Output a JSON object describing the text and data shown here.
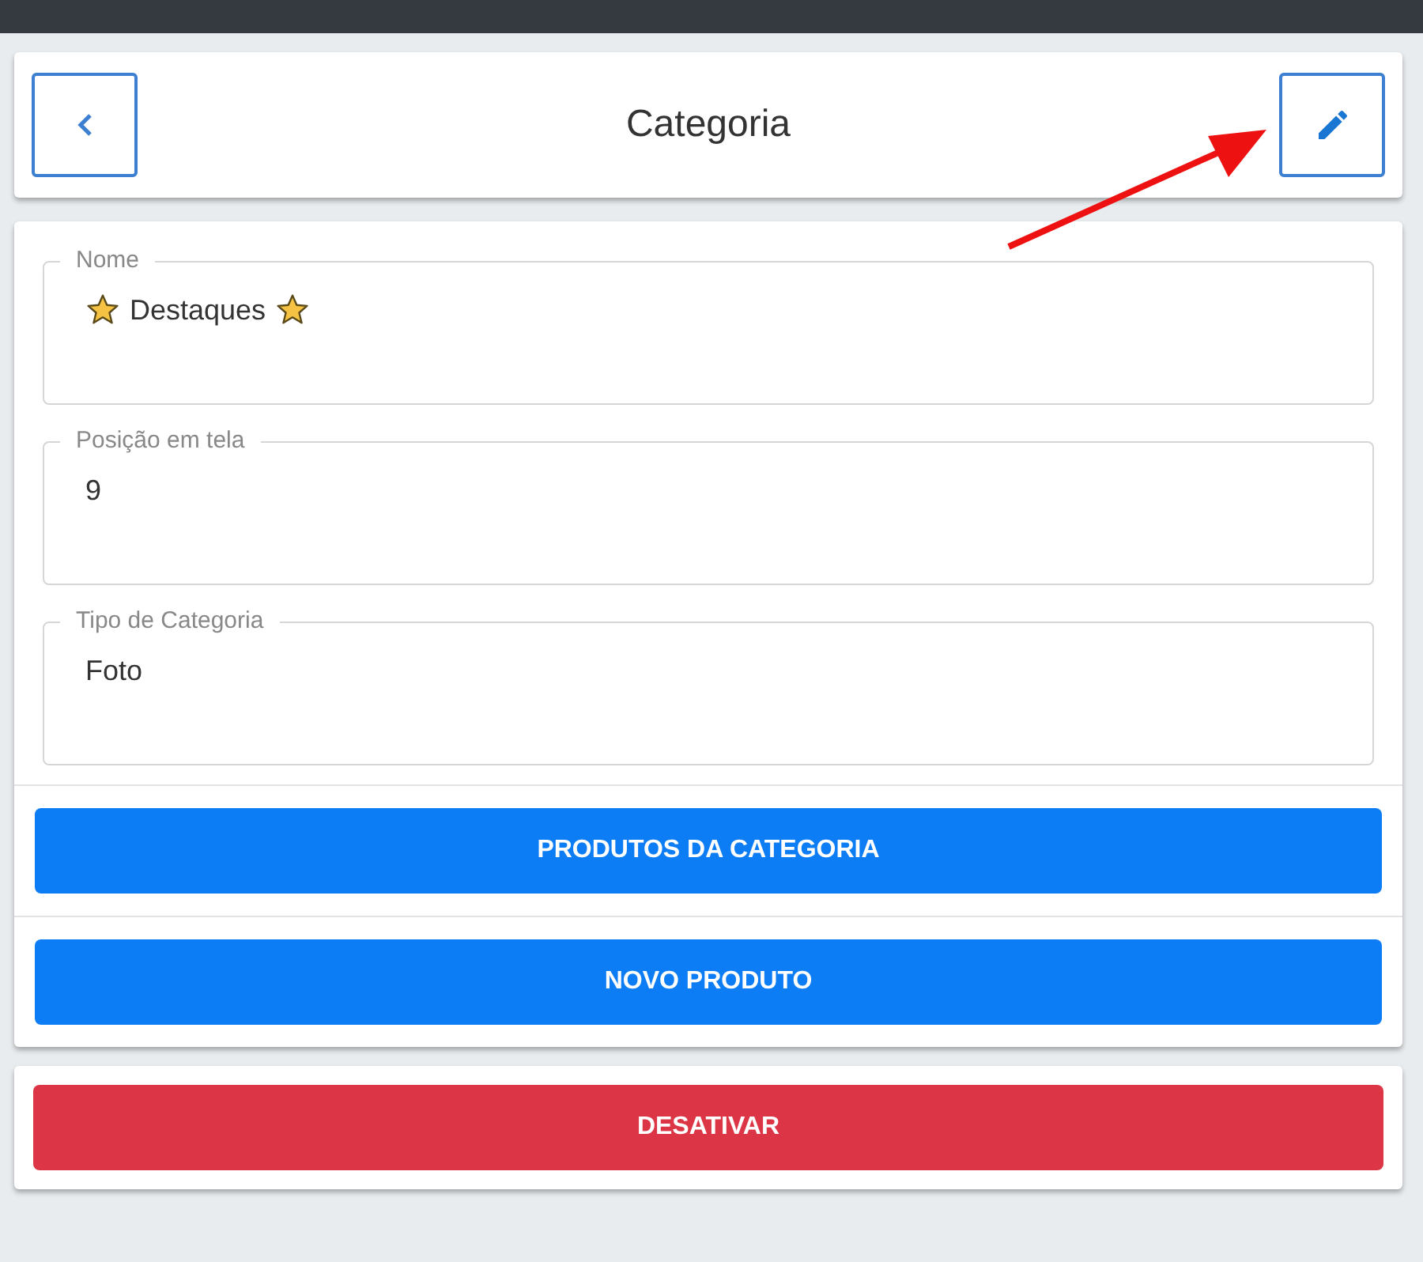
{
  "header": {
    "title": "Categoria"
  },
  "fields": [
    {
      "label": "Nome",
      "value": "Destaques",
      "kind": "starred"
    },
    {
      "label": "Posição em tela",
      "value": "9",
      "kind": "plain"
    },
    {
      "label": "Tipo de Categoria",
      "value": "Foto",
      "kind": "plain"
    }
  ],
  "actions": [
    {
      "label": "PRODUTOS DA CATEGORIA",
      "kind": "primary"
    },
    {
      "label": "NOVO PRODUTO",
      "kind": "primary"
    }
  ],
  "danger_action": {
    "label": "DESATIVAR",
    "kind": "danger"
  }
}
